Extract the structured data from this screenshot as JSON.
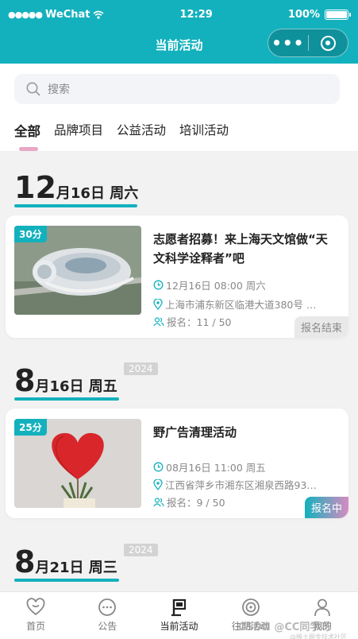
{
  "status": {
    "carrier": "WeChat",
    "time": "12:29",
    "battery": "100%"
  },
  "nav": {
    "title": "当前活动"
  },
  "search": {
    "placeholder": "搜索"
  },
  "tabs": [
    {
      "label": "全部",
      "active": true
    },
    {
      "label": "品牌项目",
      "active": false
    },
    {
      "label": "公益活动",
      "active": false
    },
    {
      "label": "培训活动",
      "active": false
    }
  ],
  "groups": [
    {
      "day": "12",
      "rest": "月16日 周六",
      "year": "",
      "card": {
        "score": "30分",
        "title": "志愿者招募！来上海天文馆做“天文科学诠释者”吧",
        "time": "12月16日 08:00 周六",
        "address": "上海市浦东新区临港大道380号 …",
        "signup": "报名：11 / 50",
        "status": "报名结束"
      }
    },
    {
      "day": "8",
      "rest": "月16日 周五",
      "year": "2024",
      "card": {
        "score": "25分",
        "title": "野广告清理活动",
        "time": "08月16日 11:00 周五",
        "address": "江西省萍乡市湘东区湘泉西路93…",
        "signup": "报名：9 / 50",
        "status": "报名中"
      }
    },
    {
      "day": "8",
      "rest": "月21日 周三",
      "year": "2024"
    }
  ],
  "tabbar": [
    {
      "label": "首页",
      "icon": "heart-icon"
    },
    {
      "label": "公告",
      "icon": "chat-icon"
    },
    {
      "label": "当前活动",
      "icon": "flag-icon",
      "active": true
    },
    {
      "label": "往期活动",
      "icon": "target-icon"
    },
    {
      "label": "我的",
      "icon": "user-icon"
    }
  ],
  "watermark": {
    "text": "CSDN @CC同学呀",
    "sub": "@稀土掘金技术社区"
  },
  "colors": {
    "accent": "#13b1bd",
    "pink": "#d68bc1"
  }
}
